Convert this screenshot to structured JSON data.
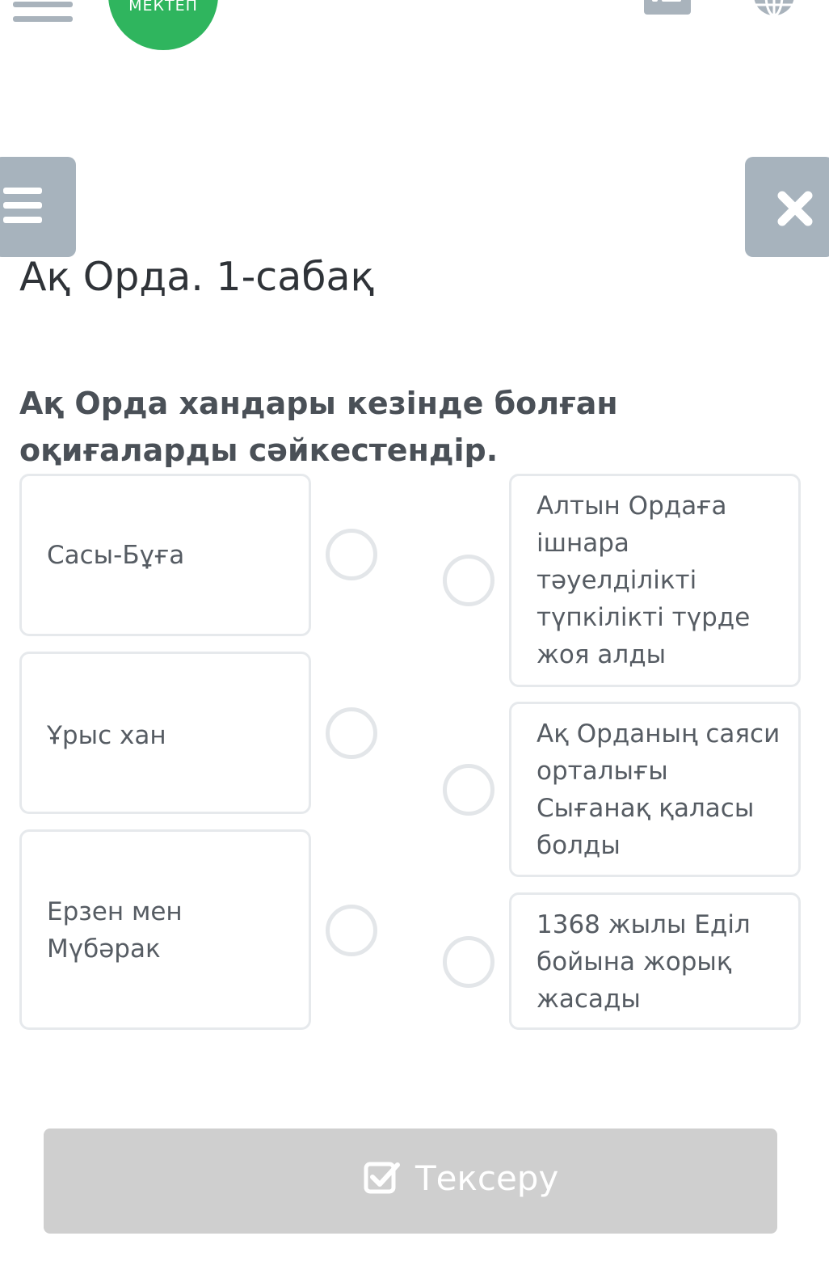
{
  "app": {
    "logo_text": "МЕКТЕП"
  },
  "lesson": {
    "title": "Ақ Орда. 1-сабақ",
    "question": "Ақ Орда хандары кезінде болған оқиғаларды сәйкестендір."
  },
  "left_items": [
    {
      "label": "Сасы-Бұға"
    },
    {
      "label": "Ұрыс хан"
    },
    {
      "label": "Ерзен мен Мүбәрак"
    }
  ],
  "right_items": [
    {
      "label": "Алтын Ордаға ішнара тәуелділікті түпкілікті түрде жоя алды"
    },
    {
      "label": "Ақ Орданың саяси орталығы Сығанақ қаласы болды"
    },
    {
      "label": "1368 жылы Еділ бойына жорық жасады"
    }
  ],
  "actions": {
    "check_label": "Тексеру"
  },
  "icons": {
    "app_menu": "hamburger-icon",
    "profile": "user-card-icon",
    "language": "globe-icon",
    "lesson_menu": "menu-icon",
    "close": "close-icon",
    "check": "checkbox-icon"
  },
  "colors": {
    "brand_green": "#2fb55e",
    "toolbar_gray": "#a7b3bd",
    "button_disabled": "#cfcfcf",
    "card_border": "#e6e9ec"
  }
}
